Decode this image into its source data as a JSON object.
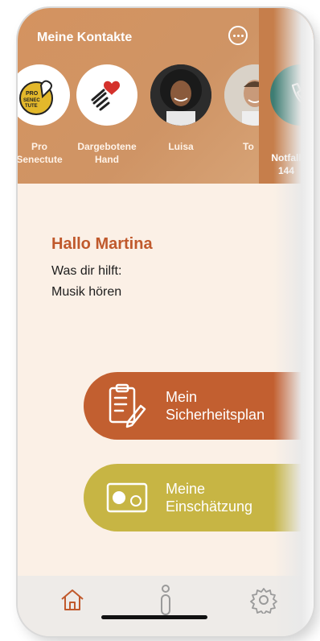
{
  "header": {
    "title": "Meine Kontakte",
    "more_icon": "more-horizontal-icon"
  },
  "contacts": [
    {
      "label": "Pro Senectute",
      "display_label_line1": "Pro",
      "display_label_line2": "Senectute",
      "icon": "pro-senectute-logo"
    },
    {
      "label": "Dargebotene Hand",
      "display_label_line1": "Dargebotene",
      "display_label_line2": "Hand",
      "icon": "hand-heart-icon"
    },
    {
      "label": "Luisa",
      "display_label_line1": "Luisa",
      "display_label_line2": "",
      "icon": "luisa-avatar"
    },
    {
      "label": "Tom",
      "display_label_line1": "To",
      "display_label_line2": "",
      "icon": "tom-avatar"
    }
  ],
  "emergency": {
    "label_line1": "Notfall",
    "label_line2": "144",
    "icon": "phone-icon",
    "color": "#3e7d73"
  },
  "main": {
    "greeting": "Hallo Martina",
    "help_title": "Was dir hilft:",
    "help_item": "Musik hören"
  },
  "actions": [
    {
      "line1": "Mein",
      "line2": "Sicherheitsplan",
      "icon": "clipboard-pen-icon",
      "color": "#c25f30"
    },
    {
      "line1": "Meine",
      "line2": "Einschätzung",
      "icon": "toggle-slider-icon",
      "color": "#c7b544"
    }
  ],
  "nav": {
    "items": [
      {
        "icon": "home-icon"
      },
      {
        "icon": "info-icon"
      },
      {
        "icon": "settings-gear-icon"
      }
    ],
    "accent": "#c0592c"
  }
}
